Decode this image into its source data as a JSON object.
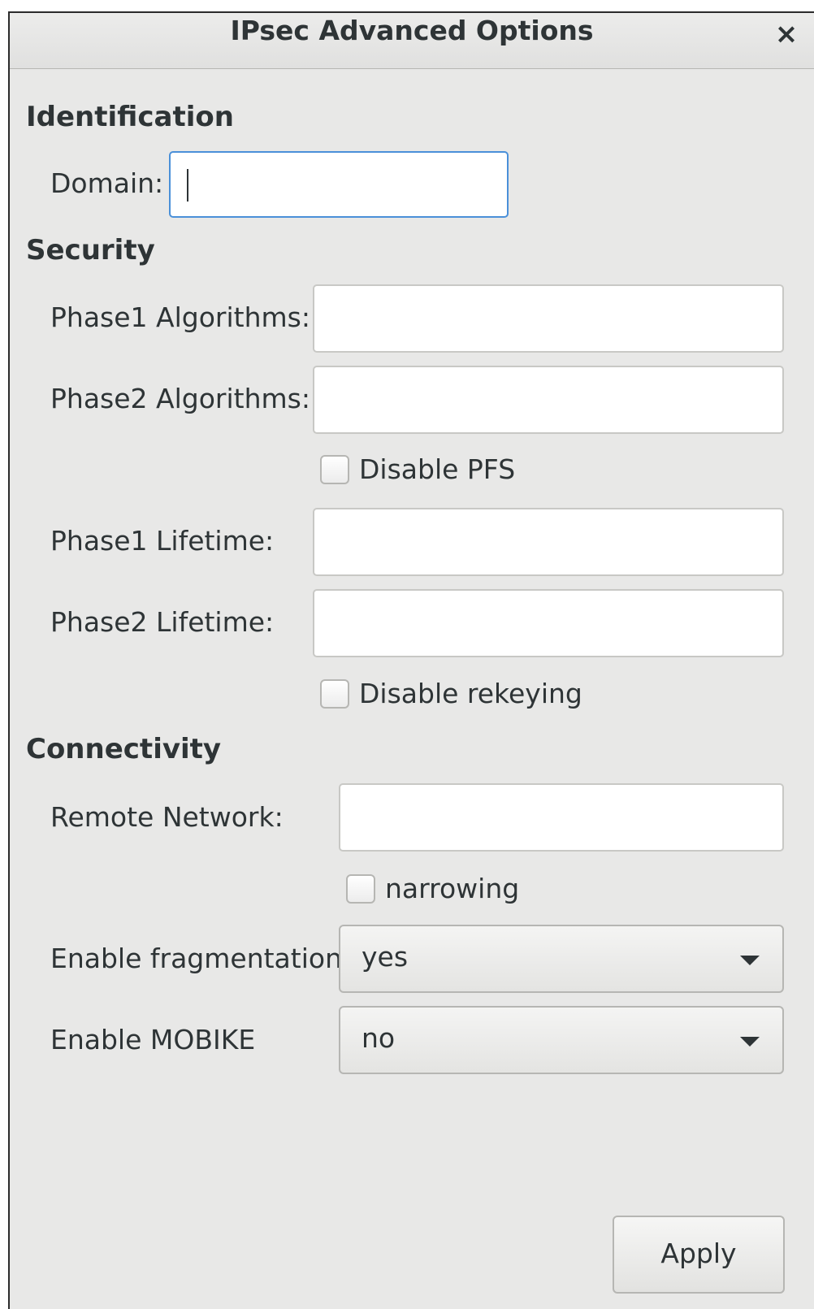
{
  "window": {
    "title": "IPsec Advanced Options",
    "close_glyph": "×"
  },
  "identification": {
    "heading": "Identification",
    "domain_label": "Domain:",
    "domain_value": ""
  },
  "security": {
    "heading": "Security",
    "phase1_algorithms_label": "Phase1 Algorithms:",
    "phase1_algorithms_value": "",
    "phase2_algorithms_label": "Phase2 Algorithms:",
    "phase2_algorithms_value": "",
    "disable_pfs_label": "Disable PFS",
    "disable_pfs_checked": false,
    "phase1_lifetime_label": "Phase1 Lifetime:",
    "phase1_lifetime_value": "",
    "phase2_lifetime_label": "Phase2 Lifetime:",
    "phase2_lifetime_value": "",
    "disable_rekeying_label": "Disable rekeying",
    "disable_rekeying_checked": false
  },
  "connectivity": {
    "heading": "Connectivity",
    "remote_network_label": "Remote Network:",
    "remote_network_value": "",
    "narrowing_label": "narrowing",
    "narrowing_checked": false,
    "fragmentation_label": "Enable fragmentation",
    "fragmentation_value": "yes",
    "mobike_label": "Enable MOBIKE",
    "mobike_value": "no"
  },
  "actions": {
    "apply_label": "Apply"
  },
  "icons": {
    "close": "close-icon",
    "dropdown": "chevron-down-icon"
  },
  "colors": {
    "focus_border": "#4a90d9",
    "background": "#e8e8e7"
  }
}
